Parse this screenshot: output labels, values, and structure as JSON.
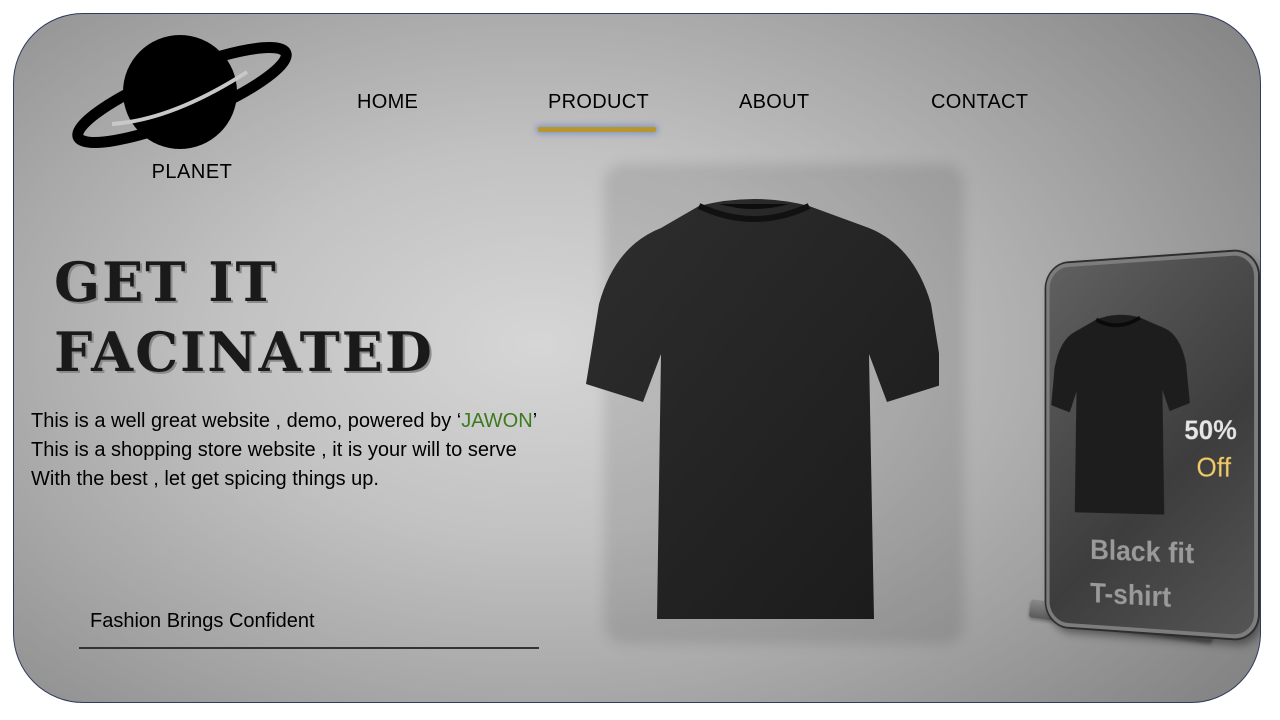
{
  "brand": {
    "name": "PLANET",
    "logo_icon": "planet-icon"
  },
  "nav": {
    "items": [
      {
        "label": "HOME"
      },
      {
        "label": "PRODUCT",
        "active": true
      },
      {
        "label": "ABOUT"
      },
      {
        "label": "CONTACT"
      }
    ],
    "active_underline_color": "#b8962e"
  },
  "hero": {
    "headline_line1": "GET IT",
    "headline_line2": "FACINATED",
    "desc_line1_prefix": "This is a well great website , demo, powered by  ‘",
    "desc_brand": "JAWON",
    "desc_line1_suffix": "’",
    "desc_line2": "This is a shopping store website , it  is your will to serve",
    "desc_line3": "With the best , let get spicing things up.",
    "brand_color": "#3d7a1e",
    "tagline": "Fashion Brings Confident",
    "product_image": "black-tshirt-image"
  },
  "product_card": {
    "discount_percent": "50%",
    "discount_word": "Off",
    "product_name_line1": "Black fit",
    "product_name_line2": "T-shirt",
    "accent_color": "#f2cc66"
  }
}
